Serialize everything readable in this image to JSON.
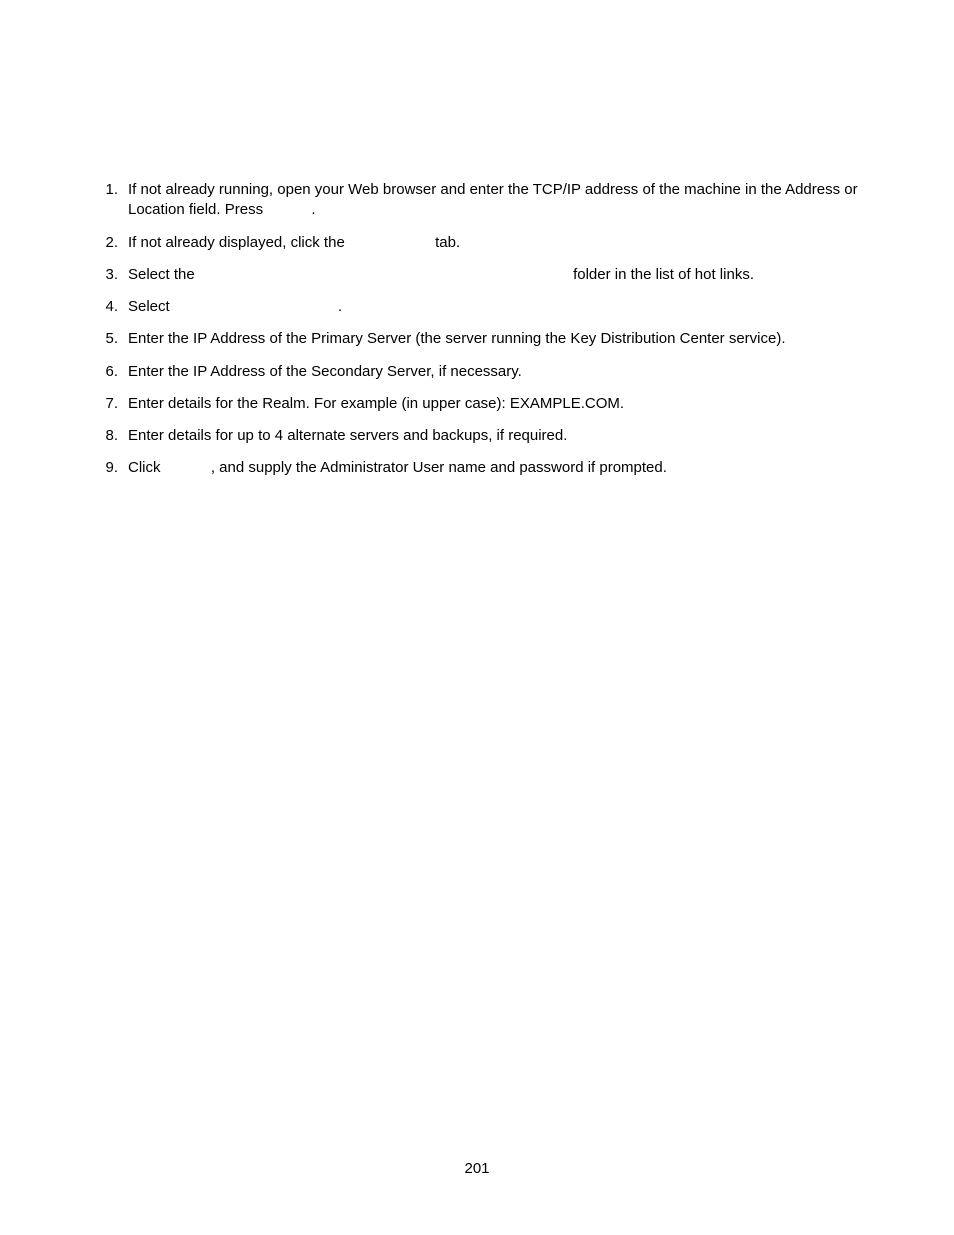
{
  "steps": [
    {
      "n": "1.",
      "a": "If not already running, open your Web browser and enter the TCP/IP address of the machine in the Address or Location field. Press",
      "gap": "gap-small",
      "b": "."
    },
    {
      "n": "2.",
      "a": "If not already displayed, click the",
      "gap": "gap-med",
      "b": "tab."
    },
    {
      "n": "3.",
      "a": "Select the",
      "gap": "gap-large",
      "b": "folder in the list of hot links."
    },
    {
      "n": "4.",
      "a": "Select",
      "gap": "gap-sel",
      "b": "."
    },
    {
      "n": "5.",
      "a": "Enter the IP Address of the Primary Server (the server running the Key Distribution Center service).",
      "gap": "",
      "b": ""
    },
    {
      "n": "6.",
      "a": "Enter the IP Address of the Secondary Server, if necessary.",
      "gap": "",
      "b": ""
    },
    {
      "n": "7.",
      "a": "Enter details for the Realm.  For example (in upper case): EXAMPLE.COM.",
      "gap": "",
      "b": ""
    },
    {
      "n": "8.",
      "a": "Enter details for up to 4 alternate servers and backups, if required.",
      "gap": "",
      "b": ""
    },
    {
      "n": "9.",
      "a": "Click",
      "gap": "gap-click",
      "b": ", and supply the Administrator User name and password if prompted."
    }
  ],
  "pageNumber": "201"
}
